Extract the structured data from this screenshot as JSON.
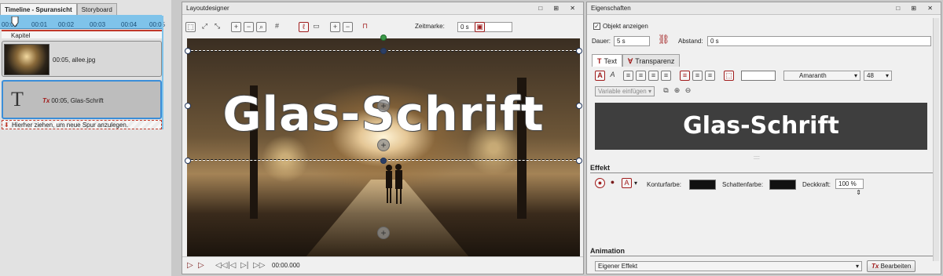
{
  "timeline": {
    "tabs": [
      "Timeline - Spuransicht",
      "Storyboard"
    ],
    "ruler": [
      "00:00",
      "00:01",
      "00:02",
      "00:03",
      "00:04",
      "00:05"
    ],
    "chapter_label": "Kapitel",
    "tracks": [
      {
        "label": "00:05, allee.jpg"
      },
      {
        "label": "00:05, Glas-Schrift",
        "glyph": "T",
        "fx": "Tx"
      }
    ],
    "hint": "Hierher ziehen, um neue Spur anzulegen."
  },
  "layout": {
    "title": "Layoutdesigner",
    "window_controls": "□ ⊞ ✕",
    "zeitmarke_label": "Zeitmarke:",
    "zeitmarke_value": "0 s",
    "canvas_text": "Glas-Schrift",
    "time": "00:00.000"
  },
  "props": {
    "title": "Eigenschaften",
    "window_controls": "□ ⊞ ✕",
    "show_object": "Objekt anzeigen",
    "show_object_checked": true,
    "dauer_label": "Dauer:",
    "dauer_value": "5 s",
    "abstand_label": "Abstand:",
    "abstand_value": "0 s",
    "tabs": [
      {
        "icon": "T",
        "label": "Text"
      },
      {
        "icon": "Ɐ",
        "label": "Transparenz"
      }
    ],
    "font_name": "Amaranth",
    "font_size": "48",
    "variable": "Variable einfügen",
    "preview_text": "Glas-Schrift",
    "effekt_title": "Effekt",
    "konturfarbe": "Konturfarbe:",
    "schattenfarbe": "Schattenfarbe:",
    "deckkraft": "Deckkraft:",
    "deckkraft_value": "100 %",
    "animation_title": "Animation",
    "animation_value": "Eigener Effekt",
    "bearbeiten": "Bearbeiten"
  },
  "colors": {
    "accent": "#a01c1c",
    "timeline_blue": "#7fc3ea",
    "selection": "#3b8ed8"
  }
}
